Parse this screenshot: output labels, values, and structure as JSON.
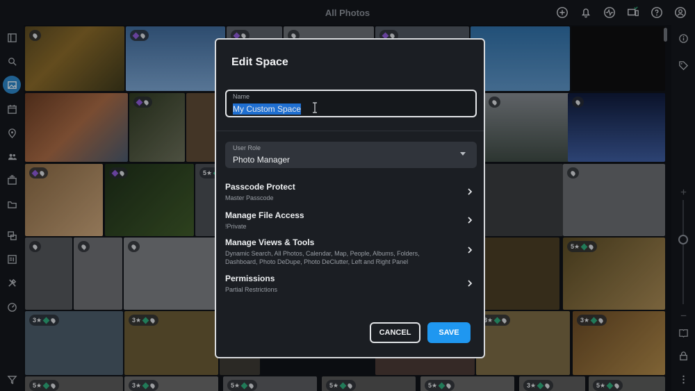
{
  "topbar": {
    "title": "All Photos"
  },
  "top_icons": [
    "add-circle-icon",
    "bell-icon",
    "activity-icon",
    "devices-icon",
    "help-icon",
    "account-icon"
  ],
  "left_icons": [
    "panel-toggle-icon",
    "search-icon",
    "photos-icon",
    "calendar-icon",
    "map-pin-icon",
    "people-icon",
    "albums-icon",
    "folder-icon",
    "dedupe-icon",
    "dashboard-icon",
    "tools-icon",
    "gauge-icon",
    "filter-icon"
  ],
  "right_icons": [
    "info-icon",
    "tag-icon",
    "zoom-in-icon",
    "zoom-out-icon",
    "book-icon",
    "lock-box-icon",
    "more-icon"
  ],
  "grid": {
    "badges": [
      "",
      "",
      "",
      "",
      "",
      "",
      "",
      "",
      "",
      "",
      "5",
      "",
      "",
      "",
      "",
      "5",
      "3",
      "3",
      "3",
      "5",
      "3",
      "5",
      "5",
      "3",
      "3",
      "5"
    ]
  },
  "modal": {
    "title": "Edit Space",
    "name_label": "Name",
    "name_value": "My Custom Space",
    "role_label": "User Role",
    "role_value": "Photo Manager",
    "rows": [
      {
        "title": "Passcode Protect",
        "sub": "Master Passcode"
      },
      {
        "title": "Manage File Access",
        "sub": "!Private"
      },
      {
        "title": "Manage Views & Tools",
        "sub": "Dynamic Search, All Photos, Calendar, Map, People, Albums, Folders, Dashboard, Photo DeDupe, Photo DeClutter, Left and Right Panel"
      },
      {
        "title": "Permissions",
        "sub": "Partial Restrictions"
      }
    ],
    "cancel_label": "CANCEL",
    "save_label": "SAVE"
  },
  "colors": {
    "accent": "#1f97f0",
    "selection": "#1f6fd1",
    "active_nav": "#2d86c7"
  }
}
